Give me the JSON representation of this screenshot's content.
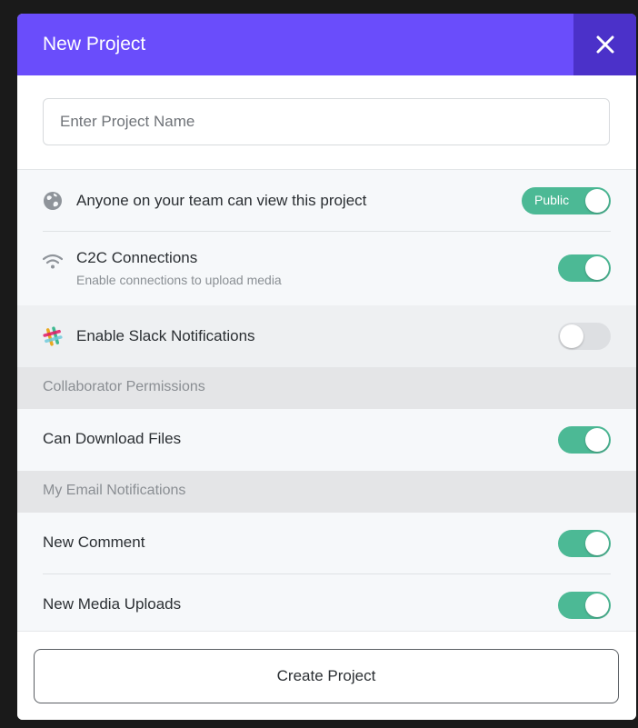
{
  "header": {
    "title": "New Project"
  },
  "project_name": {
    "placeholder": "Enter Project Name",
    "value": ""
  },
  "settings": {
    "visibility": {
      "label": "Anyone on your team can view this project",
      "toggle_label": "Public",
      "on": true
    },
    "c2c": {
      "label": "C2C Connections",
      "sublabel": "Enable connections to upload media",
      "on": true
    },
    "slack": {
      "label": "Enable Slack Notifications",
      "on": false
    }
  },
  "collaborator": {
    "heading": "Collaborator Permissions",
    "can_download": {
      "label": "Can Download Files",
      "on": true
    }
  },
  "email": {
    "heading": "My Email Notifications",
    "new_comment": {
      "label": "New Comment",
      "on": true
    },
    "new_media": {
      "label": "New Media Uploads",
      "on": true
    }
  },
  "footer": {
    "create_label": "Create Project"
  },
  "colors": {
    "accent": "#6a4dfb",
    "accent_dark": "#4b31c9",
    "toggle_on": "#4cb995",
    "toggle_off": "#dddfe2"
  }
}
